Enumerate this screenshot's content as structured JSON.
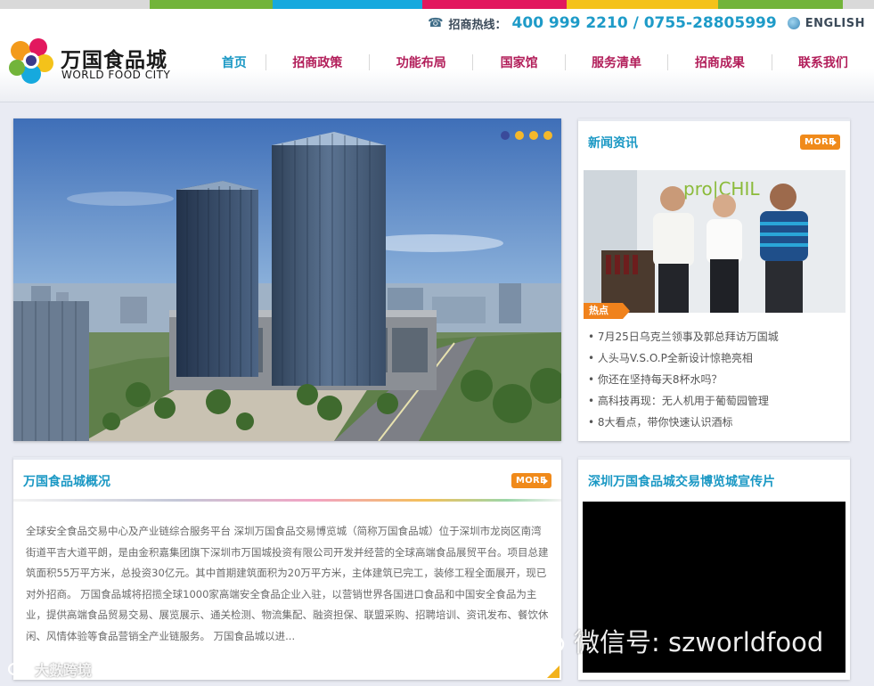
{
  "colors": {
    "top_strip": [
      "#d9d9d9",
      "#72b43a",
      "#16a9de",
      "#e2185e",
      "#f4c21a",
      "#72b43a",
      "#d9d9d9"
    ],
    "accent_blue": "#1a98c4",
    "accent_red": "#b21e5a",
    "more_orange": "#f08a1a"
  },
  "header": {
    "hotline_label": "招商热线：",
    "hotline_numbers": "400 999 2210 / 0755-28805999",
    "language": "ENGLISH",
    "phone_icon": "phone-icon",
    "globe_icon": "globe-icon"
  },
  "logo": {
    "cn": "万国食品城",
    "en": "WORLD FOOD CITY"
  },
  "nav": {
    "items": [
      "首页",
      "招商政策",
      "功能布局",
      "国家馆",
      "服务清单",
      "招商成果",
      "联系我们"
    ],
    "active_index": 0
  },
  "hero": {
    "slide_count": 4,
    "active_slide": 1
  },
  "news": {
    "title": "新闻资讯",
    "more": "MORE",
    "hot_tag": "热点",
    "photo_sign": "pro|CHIL",
    "items": [
      "7月25日乌克兰领事及郭总拜访万国城",
      "人头马V.S.O.P全新设计惊艳亮相",
      "你还在坚持每天8杯水吗？",
      "高科技再现：无人机用于葡萄园管理",
      "8大看点，带你快速认识酒标"
    ]
  },
  "intro": {
    "title": "万国食品城概况",
    "more": "MORE",
    "text": "全球安全食品交易中心及产业链综合服务平台 深圳万国食品交易博览城（简称万国食品城）位于深圳市龙岗区南湾街道平吉大道平朗，是由金积嘉集团旗下深圳市万国城投资有限公司开发并经营的全球高端食品展贸平台。项目总建筑面积55万平方米，总投资30亿元。其中首期建筑面积为20万平方米，主体建筑已完工，装修工程全面展开，现已对外招商。 万国食品城将招揽全球1000家高端安全食品企业入驻，以营销世界各国进口食品和中国安全食品为主业，提供高端食品贸易交易、展览展示、通关检测、物流集配、融资担保、联盟采购、招聘培训、资讯发布、餐饮休闲、风情体验等食品营销全产业链服务。 万国食品城以进..."
  },
  "video": {
    "title": "深圳万国食品城交易博览城宣传片"
  },
  "watermark": {
    "wechat": "微信号: szworldfood",
    "source": "大數跨境"
  }
}
